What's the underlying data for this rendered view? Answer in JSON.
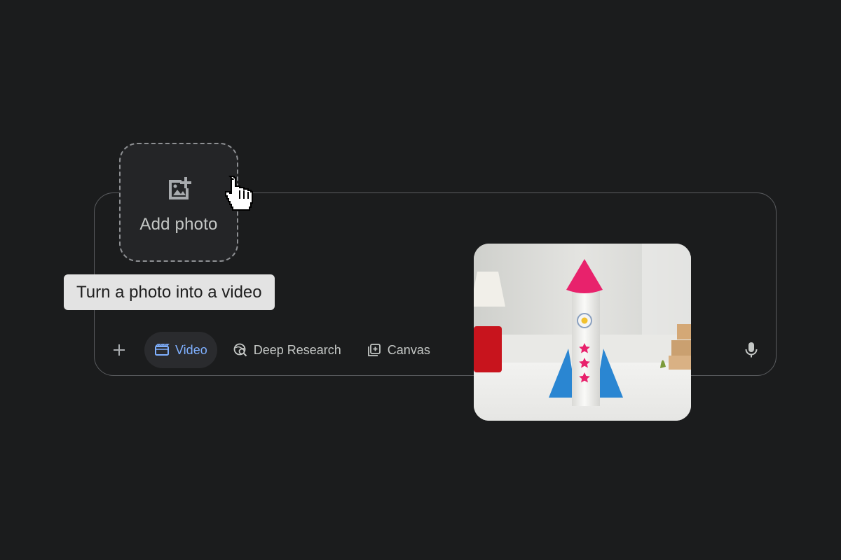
{
  "add_photo": {
    "label": "Add photo",
    "icon": "add-photo-icon"
  },
  "tooltip": {
    "text": "Turn a photo into a video"
  },
  "toolbar": {
    "plus_icon": "plus-icon",
    "chips": [
      {
        "label": "Video",
        "icon": "video-icon",
        "active": true
      },
      {
        "label": "Deep Research",
        "icon": "deep-research-icon",
        "active": false
      },
      {
        "label": "Canvas",
        "icon": "canvas-icon",
        "active": false
      }
    ],
    "mic_icon": "microphone-icon"
  },
  "photo": {
    "subject": "paper rocket"
  },
  "colors": {
    "background": "#1b1c1d",
    "accent": "#7fb0ff",
    "text": "#c4c7c5",
    "tooltip_bg": "#e3e3e3"
  }
}
